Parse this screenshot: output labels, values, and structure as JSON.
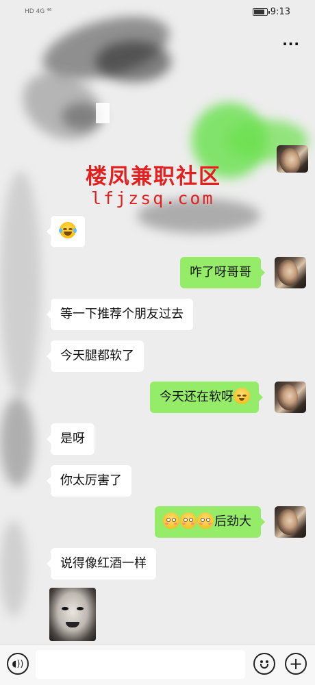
{
  "status_bar": {
    "left_indicators": "HD 4G ⁴⁶",
    "time": "9:13"
  },
  "header": {
    "more_icon": "ellipsis-icon"
  },
  "watermark": {
    "line1": "楼凤兼职社区",
    "line2": "lfjzsq.com"
  },
  "messages": [
    {
      "side": "in",
      "type": "emoji",
      "emoji": "face-with-tears-of-joy"
    },
    {
      "side": "out",
      "type": "text",
      "text": "咋了呀哥哥"
    },
    {
      "side": "in",
      "type": "text",
      "text": "等一下推荐个朋友过去"
    },
    {
      "side": "in",
      "type": "text",
      "text": "今天腿都软了"
    },
    {
      "side": "out",
      "type": "text",
      "text": "今天还在软呀",
      "emoji": "666-emoji"
    },
    {
      "side": "in",
      "type": "text",
      "text": "是呀"
    },
    {
      "side": "in",
      "type": "text",
      "text": "你太厉害了"
    },
    {
      "side": "out",
      "type": "text",
      "text": "后劲大",
      "emoji_prefix": "flushed-face x3"
    },
    {
      "side": "in",
      "type": "text",
      "text": "说得像红酒一样"
    },
    {
      "side": "in",
      "type": "sticker",
      "sticker": "meme-face"
    }
  ],
  "input_bar": {
    "voice_icon": "voice-icon",
    "placeholder": "",
    "emoji_icon": "smiley-icon",
    "plus_icon": "plus-icon"
  },
  "colors": {
    "background": "#ededed",
    "bubble_out": "#95ec69",
    "bubble_in": "#ffffff",
    "watermark": "#e32020"
  }
}
